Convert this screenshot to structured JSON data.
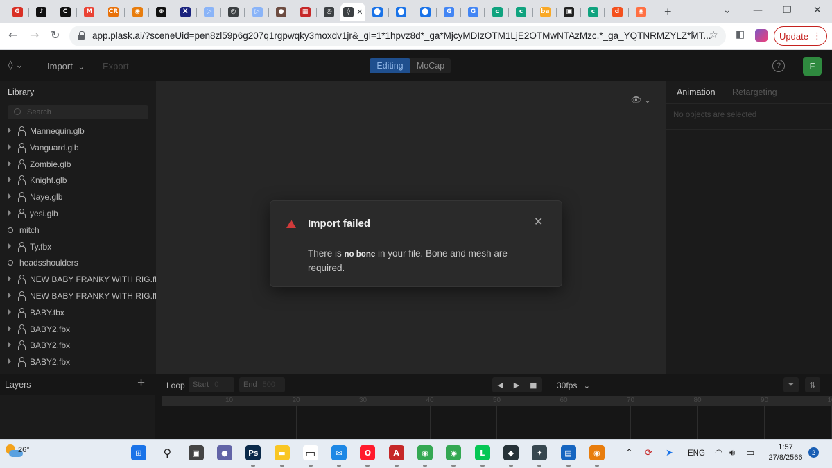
{
  "browser": {
    "tabs": [
      {
        "icon": "mail-icon",
        "color": "#d93025",
        "glyph": "G"
      },
      {
        "icon": "tiktok-icon",
        "color": "#111111",
        "glyph": "♪"
      },
      {
        "icon": "capcut-icon",
        "color": "#111111",
        "glyph": "C"
      },
      {
        "icon": "gmail-icon",
        "color": "#ea4335",
        "glyph": "M"
      },
      {
        "icon": "cr-icon",
        "color": "#e8710a",
        "glyph": "CR"
      },
      {
        "icon": "blender-icon",
        "color": "#e87d0d",
        "glyph": "◉"
      },
      {
        "icon": "studio-icon",
        "color": "#111111",
        "glyph": "⊛"
      },
      {
        "icon": "x-icon",
        "color": "#1a237e",
        "glyph": "X"
      },
      {
        "icon": "app-icon",
        "color": "#8ab4f8",
        "glyph": "▷"
      },
      {
        "icon": "circle-icon",
        "color": "#3c4043",
        "glyph": "◎"
      },
      {
        "icon": "app-icon",
        "color": "#8ab4f8",
        "glyph": "▷"
      },
      {
        "icon": "seal-icon",
        "color": "#6d4c41",
        "glyph": "●"
      },
      {
        "icon": "flag-icon",
        "color": "#c62828",
        "glyph": "▦"
      },
      {
        "icon": "circle-icon",
        "color": "#3c4043",
        "glyph": "◎"
      },
      {
        "icon": "plask-icon",
        "color": "#3c4043",
        "glyph": "◊",
        "active": true
      },
      {
        "icon": "pin-icon",
        "color": "#1a73e8",
        "glyph": "⬤"
      },
      {
        "icon": "pin-icon",
        "color": "#1a73e8",
        "glyph": "⬤"
      },
      {
        "icon": "pin-icon",
        "color": "#1a73e8",
        "glyph": "⬤"
      },
      {
        "icon": "google-icon",
        "color": "#4285f4",
        "glyph": "G"
      },
      {
        "icon": "google-icon",
        "color": "#4285f4",
        "glyph": "G"
      },
      {
        "icon": "gpt-icon",
        "color": "#10a37f",
        "glyph": "c"
      },
      {
        "icon": "gpt-icon",
        "color": "#10a37f",
        "glyph": "c"
      },
      {
        "icon": "ba-icon",
        "color": "#f9a825",
        "glyph": "ba"
      },
      {
        "icon": "doc-icon",
        "color": "#212121",
        "glyph": "▣"
      },
      {
        "icon": "gpt-icon",
        "color": "#10a37f",
        "glyph": "c"
      },
      {
        "icon": "d-icon",
        "color": "#f4511e",
        "glyph": "d"
      },
      {
        "icon": "dot-icon",
        "color": "#ff7043",
        "glyph": "◉"
      }
    ],
    "url": "app.plask.ai/?sceneUid=pen8zl59p6g207q1rgpwqky3moxdv1jr&_gl=1*1hpvz8d*_ga*MjcyMDIzOTM1LjE2OTMwNTAzMzc.*_ga_YQTNRMZYLZ*MT...",
    "update_label": "Update"
  },
  "app": {
    "import_label": "Import",
    "export_label": "Export",
    "mode_editing": "Editing",
    "mode_mocap": "MoCap",
    "help_glyph": "?",
    "avatar_initial": "F",
    "library": {
      "title": "Library",
      "search_placeholder": "Search",
      "items": [
        {
          "name": "Mannequin.glb",
          "kind": "model"
        },
        {
          "name": "Vanguard.glb",
          "kind": "model"
        },
        {
          "name": "Zombie.glb",
          "kind": "model"
        },
        {
          "name": "Knight.glb",
          "kind": "model"
        },
        {
          "name": "Naye.glb",
          "kind": "model"
        },
        {
          "name": "yesi.glb",
          "kind": "model"
        },
        {
          "name": "mitch",
          "kind": "folder"
        },
        {
          "name": "Ty.fbx",
          "kind": "model"
        },
        {
          "name": "headsshoulders",
          "kind": "folder"
        },
        {
          "name": "NEW BABY FRANKY WITH RIG.fb",
          "kind": "model"
        },
        {
          "name": "NEW BABY FRANKY WITH RIG.fb",
          "kind": "model"
        },
        {
          "name": "BABY.fbx",
          "kind": "model"
        },
        {
          "name": "BABY2.fbx",
          "kind": "model"
        },
        {
          "name": "BABY2.fbx",
          "kind": "model"
        },
        {
          "name": "BABY2.fbx",
          "kind": "model"
        },
        {
          "name": "BABY2.fbx",
          "kind": "model"
        }
      ]
    },
    "right_panel": {
      "tab_animation": "Animation",
      "tab_retargeting": "Retargeting",
      "empty_text": "No objects are selected"
    },
    "timeline": {
      "layers_label": "Layers",
      "loop_label": "Loop",
      "start_label": "Start",
      "start_value": "0",
      "end_label": "End",
      "end_value": "500",
      "fps": "30fps",
      "ticks": [
        "10",
        "20",
        "30",
        "40",
        "50",
        "60",
        "70",
        "80",
        "90",
        "10"
      ]
    },
    "modal": {
      "title": "Import failed",
      "msg_before": "There is ",
      "msg_bold": "no bone",
      "msg_after": " in your file. Bone and mesh are required."
    }
  },
  "taskbar": {
    "temperature": "26°",
    "lang": "ENG",
    "time": "1:57",
    "date": "27/8/2566",
    "notifications": "2",
    "apps": [
      {
        "icon": "windows-start-icon",
        "color": "#1a73e8",
        "glyph": "⊞"
      },
      {
        "icon": "search-icon",
        "color": "#e6ecf3",
        "glyph": "⚲"
      },
      {
        "icon": "task-view-icon",
        "color": "#444444",
        "glyph": "▣"
      },
      {
        "icon": "teams-chat-icon",
        "color": "#6264a7",
        "glyph": "●"
      },
      {
        "icon": "photoshop-icon",
        "color": "#0b2a4a",
        "glyph": "Ps"
      },
      {
        "icon": "file-explorer-icon",
        "color": "#f9c623",
        "glyph": "▬"
      },
      {
        "icon": "notepad-icon",
        "color": "#ffffff",
        "glyph": "▭"
      },
      {
        "icon": "mail-icon",
        "color": "#1e88e5",
        "glyph": "✉"
      },
      {
        "icon": "opera-icon",
        "color": "#ff1b2d",
        "glyph": "O"
      },
      {
        "icon": "acrobat-icon",
        "color": "#c62828",
        "glyph": "A"
      },
      {
        "icon": "chrome-icon",
        "color": "#34a853",
        "glyph": "◉"
      },
      {
        "icon": "chrome-icon",
        "color": "#34a853",
        "glyph": "◉"
      },
      {
        "icon": "line-icon",
        "color": "#06c755",
        "glyph": "L"
      },
      {
        "icon": "davinci-icon",
        "color": "#263238",
        "glyph": "◆"
      },
      {
        "icon": "rig-tool-icon",
        "color": "#37474f",
        "glyph": "✦"
      },
      {
        "icon": "screen-icon",
        "color": "#1565c0",
        "glyph": "▤"
      },
      {
        "icon": "blender-icon",
        "color": "#e87d0d",
        "glyph": "◉"
      }
    ]
  }
}
